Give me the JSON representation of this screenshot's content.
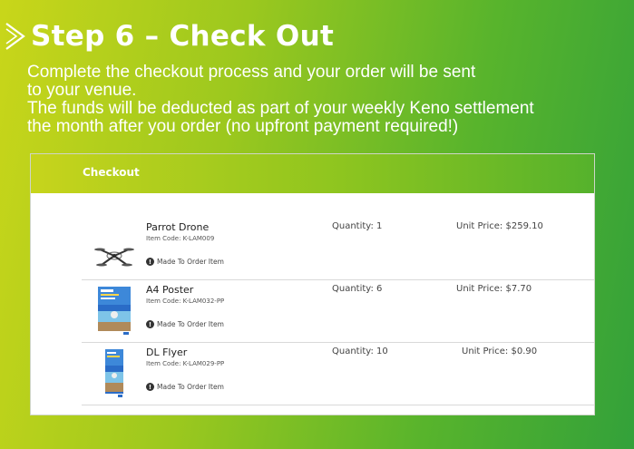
{
  "header": {
    "title": "Step 6 – Check Out"
  },
  "intro": {
    "lines": [
      "Complete the checkout process and your order will be sent",
      "to your venue.",
      "The funds will be deducted as part of your weekly Keno settlement",
      "the month after you order (no upfront payment required!)"
    ]
  },
  "checkout": {
    "title": "Checkout",
    "items": [
      {
        "name": "Parrot Drone",
        "code": "Item Code: K-LAM009",
        "note": "Made To Order Item",
        "quantity": "Quantity: 1",
        "price": "Unit Price: $259.10",
        "thumb": "drone-image"
      },
      {
        "name": "A4 Poster",
        "code": "Item Code: K-LAM032-PP",
        "note": "Made To Order Item",
        "quantity": "Quantity: 6",
        "price": "Unit Price: $7.70",
        "thumb": "poster-image"
      },
      {
        "name": "DL Flyer",
        "code": "Item Code: K-LAM029-PP",
        "note": "Made To Order Item",
        "quantity": "Quantity: 10",
        "price": "Unit Price: $0.90",
        "thumb": "flyer-image"
      }
    ]
  },
  "colors": {
    "accent_green": "#33a13a",
    "accent_lime": "#c9d61a"
  }
}
